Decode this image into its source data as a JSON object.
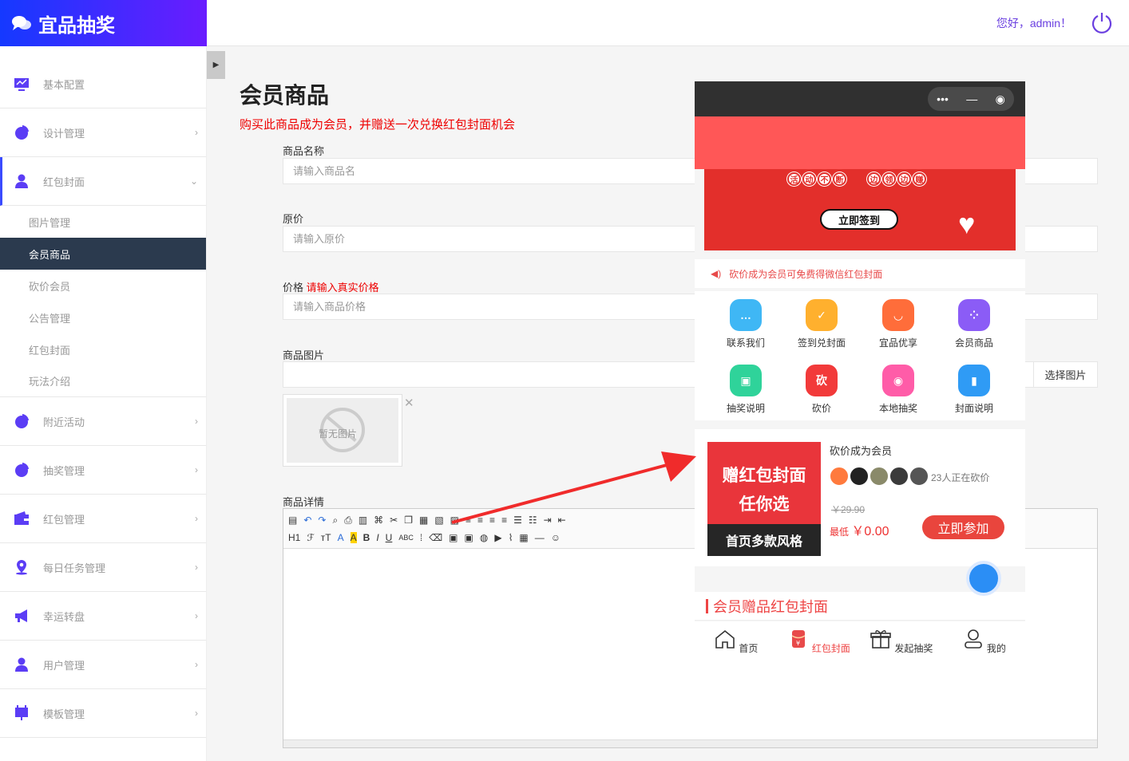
{
  "app": {
    "logo_text": "宜品抽奖",
    "greeting": "您好，admin！"
  },
  "sidebar": {
    "menus": [
      {
        "label": "基本配置"
      },
      {
        "label": "设计管理"
      },
      {
        "label": "红包封面"
      },
      {
        "label": "附近活动"
      },
      {
        "label": "抽奖管理"
      },
      {
        "label": "红包管理"
      },
      {
        "label": "每日任务管理"
      },
      {
        "label": "幸运转盘"
      },
      {
        "label": "用户管理"
      },
      {
        "label": "模板管理"
      }
    ],
    "sub_items": [
      "图片管理",
      "会员商品",
      "砍价会员",
      "公告管理",
      "红包封面",
      "玩法介绍"
    ],
    "active_sub": "会员商品"
  },
  "page": {
    "title": "会员商品",
    "note": "购买此商品成为会员，并赠送一次兑换红包封面机会"
  },
  "form": {
    "name_label": "商品名称",
    "name_placeholder": "请输入商品名",
    "orig_label": "原价",
    "orig_placeholder": "请输入原价",
    "price_label": "价格",
    "price_hint": "请输入真实价格",
    "price_placeholder": "请输入商品价格",
    "image_label": "商品图片",
    "pick_button": "选择图片",
    "no_image": "暂无图片",
    "detail_label": "商品详情",
    "editor_row2": [
      "H1",
      "ℱ",
      "тT",
      "A",
      "A",
      "B",
      "I",
      "U",
      "ABC"
    ]
  },
  "phone": {
    "banner_badge1": [
      "活",
      "动",
      "不",
      "断"
    ],
    "banner_badge2": [
      "边",
      "领",
      "边",
      "赚"
    ],
    "sign_button": "立即签到",
    "notice": "砍价成为会员可免费得微信红包封面",
    "grid": [
      {
        "label": "联系我们",
        "color": "#3fb7f5"
      },
      {
        "label": "签到兑封面",
        "color": "#ffb02e"
      },
      {
        "label": "宜品优享",
        "color": "#ff6d3a"
      },
      {
        "label": "会员商品",
        "color": "#8b5cf6"
      },
      {
        "label": "抽奖说明",
        "color": "#2fd39a"
      },
      {
        "label": "砍价",
        "color": "#f23a3a",
        "glyph": "砍"
      },
      {
        "label": "本地抽奖",
        "color": "#ff5ca8"
      },
      {
        "label": "封面说明",
        "color": "#2f9bf5"
      }
    ],
    "card": {
      "img_line1": "赠红包封面",
      "img_line2": "任你选",
      "img_line3": "首页多款风格",
      "title": "砍价成为会员",
      "count": "23人正在砍价",
      "old_price": "￥29.90",
      "low_label": "最低",
      "low_price": "￥0.00",
      "join": "立即参加"
    },
    "section": "会员赠品红包封面",
    "tabs": [
      {
        "label": "首页"
      },
      {
        "label": "红包封面"
      },
      {
        "label": "发起抽奖"
      },
      {
        "label": "我的"
      }
    ]
  },
  "colors": {
    "accent": "#6a1cff",
    "red": "#e9453d",
    "blue": "#2b8ef5"
  }
}
